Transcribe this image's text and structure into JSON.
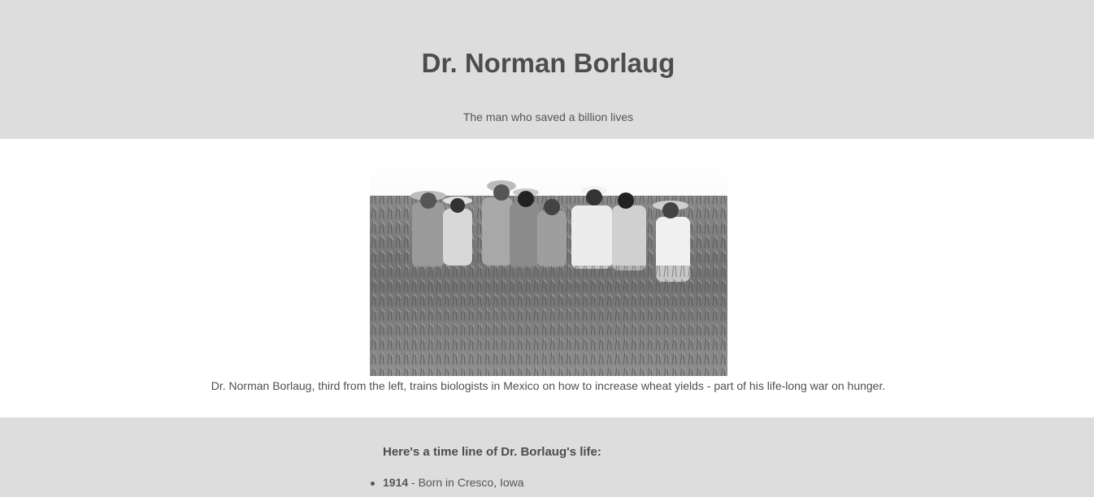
{
  "header": {
    "title": "Dr. Norman Borlaug",
    "subtitle": "The man who saved a billion lives"
  },
  "image_section": {
    "photo_icon": "black-and-white-photo-men-in-wheat-field",
    "caption": "Dr. Norman Borlaug, third from the left, trains biologists in Mexico on how to increase wheat yields - part of his life-long war on hunger."
  },
  "timeline": {
    "heading": "Here's a time line of Dr. Borlaug's life:",
    "items": [
      {
        "year": "1914",
        "text": " - Born in Cresco, Iowa"
      }
    ]
  },
  "colors": {
    "section_background": "#dddddd",
    "text": "#4d4d4d"
  }
}
